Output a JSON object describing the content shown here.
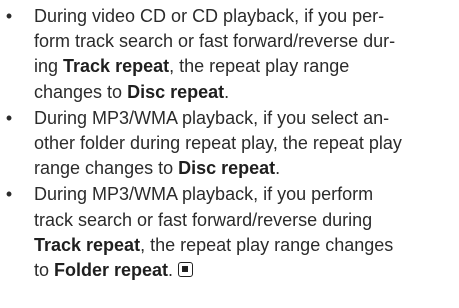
{
  "bullet_char": "•",
  "notes": [
    {
      "lines": [
        [
          "During video CD or CD playback, if you per-"
        ],
        [
          "form track search or fast forward/reverse dur-"
        ],
        [
          "ing ",
          {
            "b": "Track repeat"
          },
          ", the repeat play range"
        ],
        [
          "changes to ",
          {
            "b": "Disc repeat"
          },
          "."
        ]
      ]
    },
    {
      "lines": [
        [
          "During MP3/WMA playback, if you select an-"
        ],
        [
          "other folder during repeat play, the repeat play"
        ],
        [
          "range changes to ",
          {
            "b": "Disc repeat"
          },
          "."
        ]
      ]
    },
    {
      "lines": [
        [
          "During MP3/WMA playback, if you perform"
        ],
        [
          "track search or fast forward/reverse during"
        ],
        [
          {
            "b": "Track repeat"
          },
          ", the repeat play range changes"
        ],
        [
          "to ",
          {
            "b": "Folder repeat"
          },
          ".",
          {
            "icon": "end-of-section-icon"
          }
        ]
      ]
    }
  ]
}
